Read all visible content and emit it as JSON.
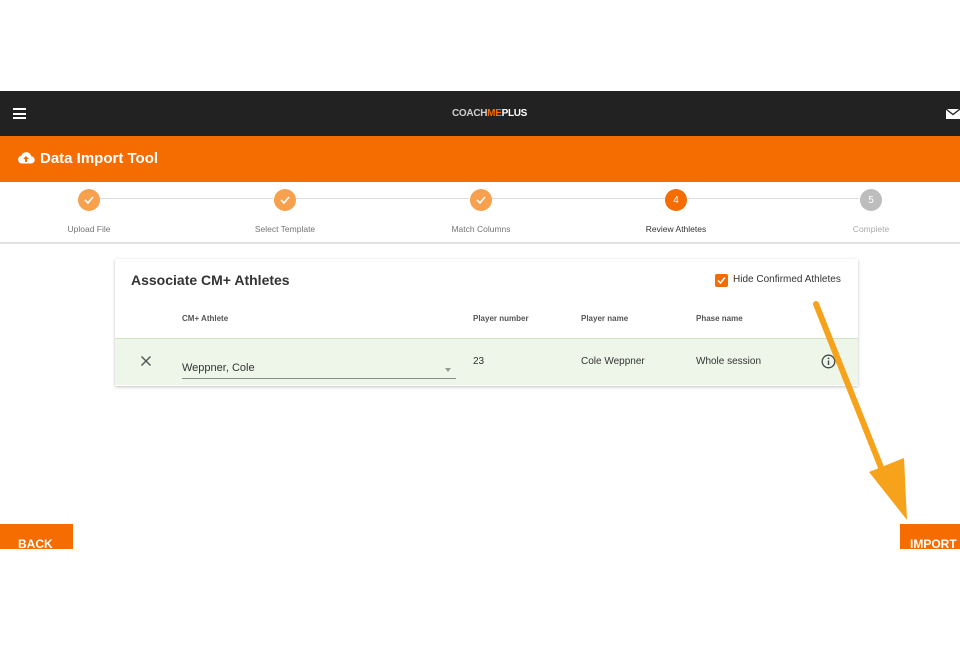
{
  "topbar": {
    "logo": {
      "part1": "COACH",
      "part2": "ME",
      "part3": "PLUS"
    },
    "menu_icon": "hamburger-menu-icon",
    "mail_icon": "mail-icon"
  },
  "app": {
    "title": "Data Import Tool",
    "icon": "cloud-upload-icon"
  },
  "steps": [
    {
      "label": "Upload File",
      "state": "done"
    },
    {
      "label": "Select Template",
      "state": "done"
    },
    {
      "label": "Match Columns",
      "state": "done"
    },
    {
      "label": "Review Athletes",
      "state": "active",
      "number": "4"
    },
    {
      "label": "Complete",
      "state": "pending",
      "number": "5"
    }
  ],
  "card": {
    "title": "Associate CM+ Athletes",
    "hide_confirmed_label": "Hide Confirmed Athletes",
    "hide_confirmed_checked": true,
    "columns": [
      "CM+ Athlete",
      "Player number",
      "Player name",
      "Phase name"
    ],
    "rows": [
      {
        "athlete": "Weppner, Cole",
        "player_number": "23",
        "player_name": "Cole Weppner",
        "phase_name": "Whole session"
      }
    ]
  },
  "buttons": {
    "back": "BACK",
    "import": "IMPORT"
  },
  "colors": {
    "brand_orange": "#f56c00",
    "topbar": "#222222",
    "row_confirmed": "#eef5e9",
    "annotation_arrow": "#f7a21b"
  }
}
